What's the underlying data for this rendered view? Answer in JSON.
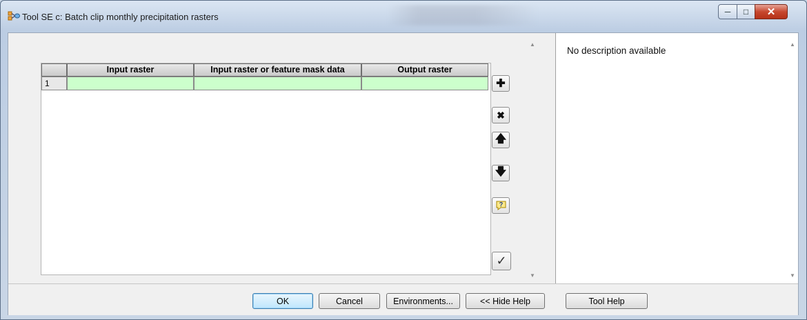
{
  "window": {
    "title": "Tool SE c: Batch clip monthly precipitation rasters",
    "controls": {
      "minimize_icon": "minimize-icon",
      "maximize_icon": "maximize-icon",
      "close_icon": "close-icon"
    }
  },
  "grid": {
    "columns": [
      "Input raster",
      "Input raster or feature mask data",
      "Output raster"
    ],
    "rows": [
      {
        "index": "1",
        "cells": [
          "",
          "",
          ""
        ]
      }
    ],
    "row_color": "#ccffcc"
  },
  "side_tools": [
    {
      "name": "add-row-button",
      "icon": "plus-icon"
    },
    {
      "name": "delete-row-button",
      "icon": "x-icon"
    },
    {
      "name": "move-up-button",
      "icon": "arrow-up-icon"
    },
    {
      "name": "move-down-button",
      "icon": "arrow-down-icon"
    },
    {
      "name": "help-button",
      "icon": "question-icon"
    },
    {
      "name": "check-button",
      "icon": "checkmark-icon"
    }
  ],
  "help_pane": {
    "description": "No description available"
  },
  "footer": {
    "ok": "OK",
    "cancel": "Cancel",
    "environments": "Environments...",
    "hide_help": "<< Hide Help",
    "tool_help": "Tool Help"
  }
}
